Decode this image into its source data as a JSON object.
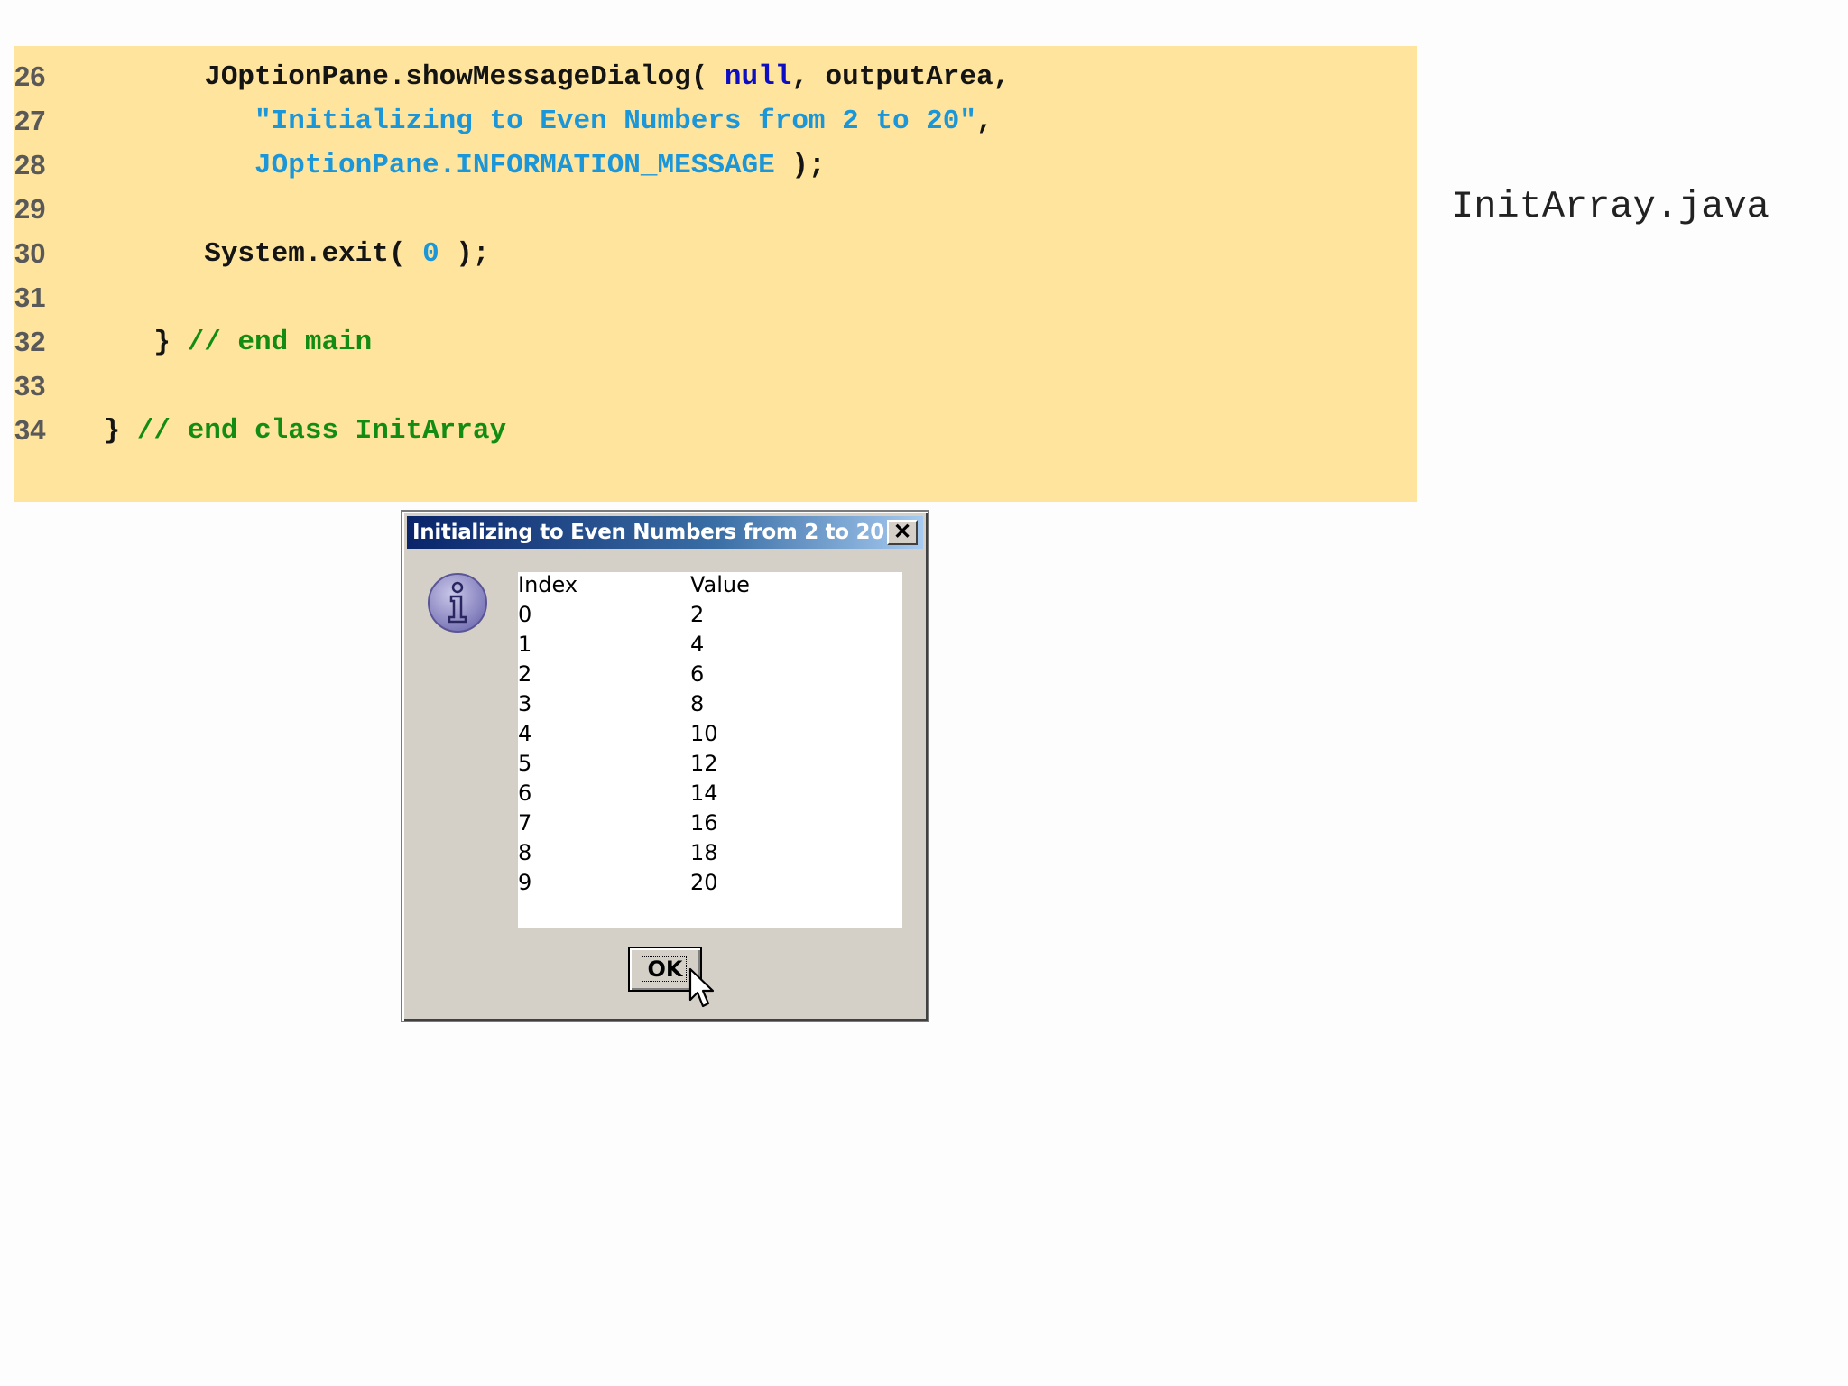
{
  "code": {
    "lines": [
      {
        "num": "26",
        "tokens": [
          {
            "t": "       JOptionPane.showMessageDialog( ",
            "c": "default"
          },
          {
            "t": "null",
            "c": "keyword"
          },
          {
            "t": ", outputArea,",
            "c": "default"
          }
        ]
      },
      {
        "num": "27",
        "tokens": [
          {
            "t": "          ",
            "c": "default"
          },
          {
            "t": "\"Initializing to Even Numbers from 2 to 20\"",
            "c": "string"
          },
          {
            "t": ",",
            "c": "default"
          }
        ]
      },
      {
        "num": "28",
        "tokens": [
          {
            "t": "          ",
            "c": "default"
          },
          {
            "t": "JOptionPane.INFORMATION_MESSAGE",
            "c": "constant"
          },
          {
            "t": " );",
            "c": "default"
          }
        ]
      },
      {
        "num": "29",
        "tokens": []
      },
      {
        "num": "30",
        "tokens": [
          {
            "t": "       System.exit( ",
            "c": "default"
          },
          {
            "t": "0",
            "c": "number"
          },
          {
            "t": " );",
            "c": "default"
          }
        ]
      },
      {
        "num": "31",
        "tokens": []
      },
      {
        "num": "32",
        "tokens": [
          {
            "t": "    } ",
            "c": "default"
          },
          {
            "t": "// end main",
            "c": "comment"
          }
        ]
      },
      {
        "num": "33",
        "tokens": []
      },
      {
        "num": "34",
        "tokens": [
          {
            "t": " } ",
            "c": "default"
          },
          {
            "t": "// end class InitArray",
            "c": "comment"
          }
        ]
      }
    ]
  },
  "filename": "InitArray.java",
  "dialog": {
    "title": "Initializing to Even Numbers from 2 to 20",
    "close_icon": "close-icon",
    "message_icon": "information-icon",
    "output": {
      "headers": [
        "Index",
        "Value"
      ],
      "rows": [
        [
          "0",
          "2"
        ],
        [
          "1",
          "4"
        ],
        [
          "2",
          "6"
        ],
        [
          "3",
          "8"
        ],
        [
          "4",
          "10"
        ],
        [
          "5",
          "12"
        ],
        [
          "6",
          "14"
        ],
        [
          "7",
          "16"
        ],
        [
          "8",
          "18"
        ],
        [
          "9",
          "20"
        ]
      ]
    },
    "ok_label": "OK"
  },
  "colors": {
    "code_background": "#fee49c",
    "keyword": "#0d0dc4",
    "string": "#1a96d9",
    "comment": "#128c12",
    "titlebar": "#0a246a"
  }
}
